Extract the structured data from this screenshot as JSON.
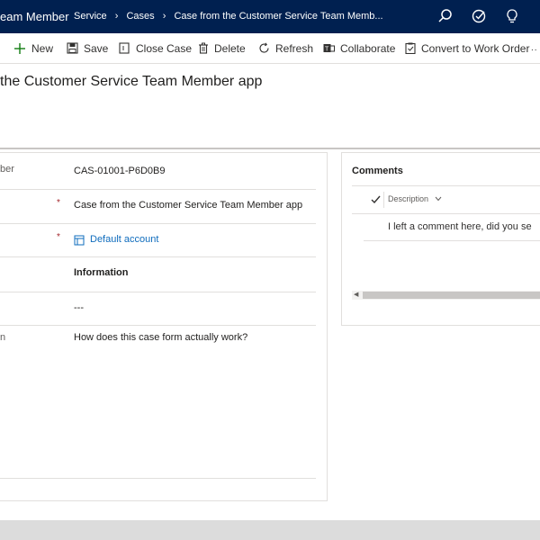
{
  "topbar": {
    "app_title": "eam Member",
    "breadcrumb": [
      "Service",
      "Cases",
      "Case from the Customer Service Team Memb..."
    ]
  },
  "toolbar": {
    "new": "New",
    "save": "Save",
    "close_case": "Close Case",
    "delete": "Delete",
    "refresh": "Refresh",
    "collaborate": "Collaborate",
    "convert": "Convert to Work Order"
  },
  "record": {
    "title": "the Customer Service Team Member app"
  },
  "form": {
    "case_number_label": "ber",
    "case_number": "CAS-01001-P6D0B9",
    "case_title": "Case from the Customer Service Team Member app",
    "customer": "Default account",
    "origin": "Information",
    "blank_value": "---",
    "description_label": "n",
    "description": "How does this case form actually work?"
  },
  "comments": {
    "header": "Comments",
    "column": "Description",
    "rows": [
      "I left a comment here, did you se"
    ]
  },
  "colors": {
    "topbar": "#002050",
    "link": "#0f6cbd",
    "required": "#a4262c"
  }
}
